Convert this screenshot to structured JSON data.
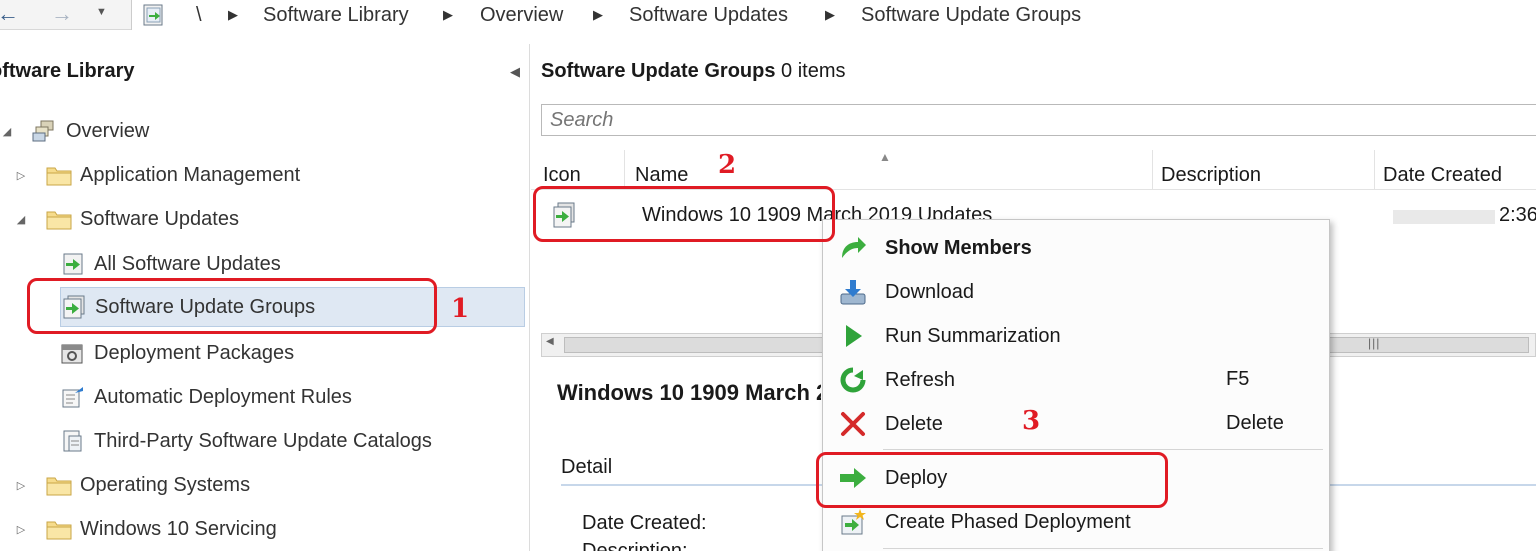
{
  "breadcrumb": {
    "root": "\\",
    "items": [
      "Software Library",
      "Overview",
      "Software Updates",
      "Software Update Groups"
    ]
  },
  "left_pane": {
    "title": "oftware Library",
    "tree": [
      {
        "label": "Overview",
        "icon": "overview-icon",
        "expand": "expanded"
      },
      {
        "label": "Application Management",
        "icon": "folder-icon",
        "expand": "collapsed"
      },
      {
        "label": "Software Updates",
        "icon": "folder-icon",
        "expand": "expanded"
      },
      {
        "label": "All Software Updates",
        "icon": "software-update-icon",
        "expand": "none"
      },
      {
        "label": "Software Update Groups",
        "icon": "update-group-icon",
        "expand": "none",
        "selected": true
      },
      {
        "label": "Deployment Packages",
        "icon": "package-icon",
        "expand": "none"
      },
      {
        "label": "Automatic Deployment Rules",
        "icon": "rule-icon",
        "expand": "none"
      },
      {
        "label": "Third-Party Software Update Catalogs",
        "icon": "catalog-icon",
        "expand": "none"
      },
      {
        "label": "Operating Systems",
        "icon": "folder-icon",
        "expand": "collapsed"
      },
      {
        "label": "Windows 10 Servicing",
        "icon": "folder-icon",
        "expand": "collapsed"
      }
    ]
  },
  "right_pane": {
    "title": "Software Update Groups",
    "count": "0 items",
    "search_placeholder": "Search",
    "columns": [
      "Icon",
      "Name",
      "Description",
      "Date Created"
    ],
    "rows": [
      {
        "name": "Windows 10 1909 March 2019 Updates",
        "date_created": "2:36"
      }
    ],
    "details": {
      "title": "Windows 10 1909 March 2019 Updates",
      "tab": "Detail",
      "fields": [
        "Date Created:",
        "Description:"
      ]
    }
  },
  "context_menu": {
    "items": [
      {
        "label": "Show Members",
        "shortcut": "",
        "icon": "show-members-icon",
        "bold": true
      },
      {
        "label": "Download",
        "shortcut": "",
        "icon": "download-icon"
      },
      {
        "label": "Run Summarization",
        "shortcut": "",
        "icon": "run-summarization-icon"
      },
      {
        "label": "Refresh",
        "shortcut": "F5",
        "icon": "refresh-icon"
      },
      {
        "label": "Delete",
        "shortcut": "Delete",
        "icon": "delete-icon"
      },
      {
        "label": "Deploy",
        "shortcut": "",
        "icon": "deploy-icon"
      },
      {
        "label": "Create Phased Deployment",
        "shortcut": "",
        "icon": "phased-deployment-icon"
      }
    ]
  },
  "annotations": {
    "step1": "1",
    "step2": "2",
    "step3": "3",
    "color": "#e01b24"
  },
  "colors": {
    "selection": "#dfe8f3",
    "accent_green": "#3cae3f",
    "delete_red": "#d42a2a"
  }
}
